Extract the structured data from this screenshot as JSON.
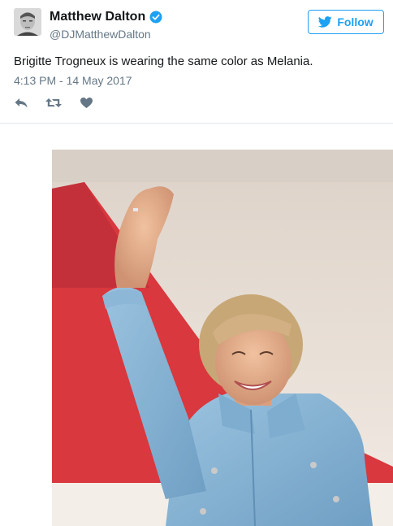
{
  "tweet": {
    "author_name": "Matthew Dalton",
    "author_handle": "@DJMatthewDalton",
    "follow_label": "Follow",
    "text": "Brigitte Trogneux is wearing the same color as Melania.",
    "timestamp": "4:13 PM - 14 May 2017",
    "icons": {
      "verified": "verified-badge-icon",
      "follow": "bird-icon",
      "reply": "reply-icon",
      "retweet": "retweet-icon",
      "like": "heart-icon"
    }
  },
  "colors": {
    "accent": "#1da1f2",
    "text": "#14171a",
    "muted": "#657786",
    "divider": "#e1e8ed"
  }
}
